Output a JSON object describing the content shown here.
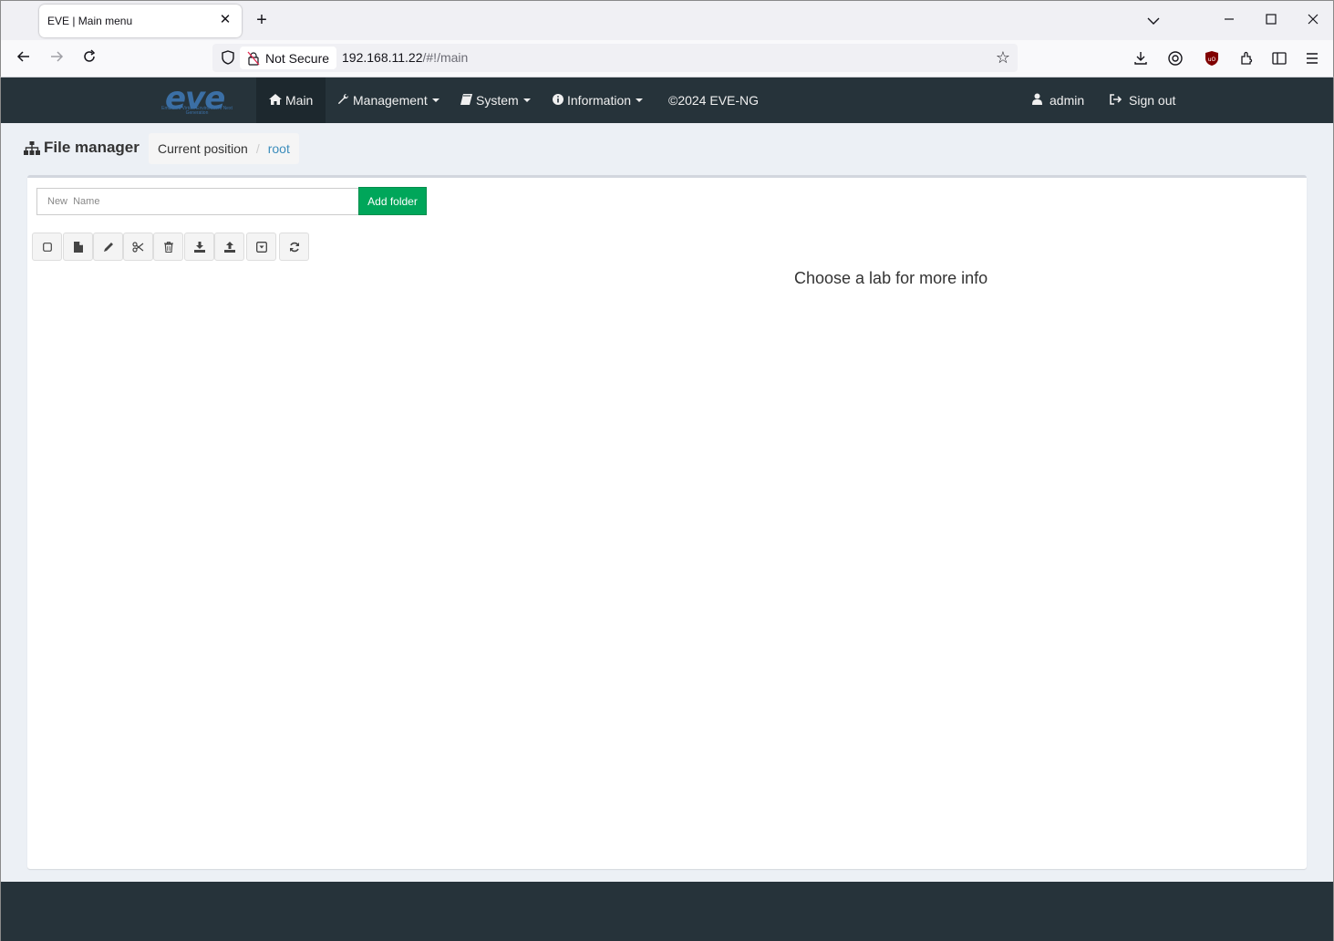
{
  "browser": {
    "tab_title": "EVE | Main menu",
    "url_security": "Not Secure",
    "url_host": "192.168.11.22",
    "url_path": "/#!/main"
  },
  "app": {
    "logo_text": "eve",
    "logo_subtext": "Emulated Virtual Environment Next Generation",
    "menu": {
      "main": "Main",
      "management": "Management",
      "system": "System",
      "information": "Information",
      "copyright": "©2024 EVE-NG"
    },
    "user": "admin",
    "signout": "Sign out"
  },
  "file_manager": {
    "title": "File manager",
    "breadcrumb_label": "Current position",
    "breadcrumb_current": "root",
    "new_name_placeholder": "New  Name",
    "add_folder_label": "Add folder",
    "info_text": "Choose a lab for more info",
    "toolbar": [
      "select-all",
      "new-file",
      "edit",
      "cut",
      "delete",
      "download",
      "upload",
      "export",
      "refresh"
    ]
  },
  "colors": {
    "nav_bg": "#26333a",
    "add_folder_bg": "#00a65a",
    "link": "#3c8dbc",
    "content_bg": "#ecf0f5"
  }
}
